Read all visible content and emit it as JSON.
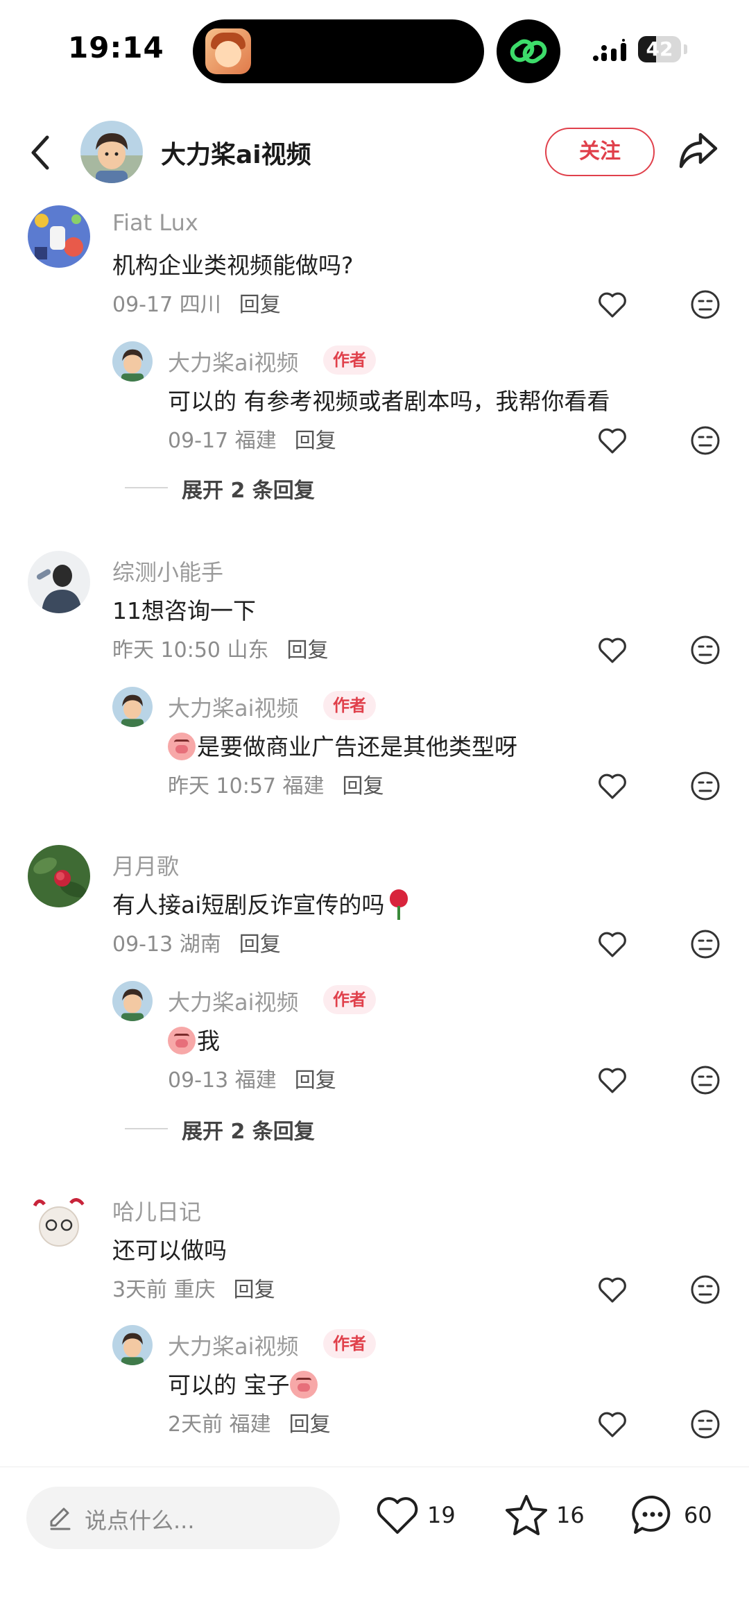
{
  "status_bar": {
    "time": "19:14",
    "battery": "42",
    "battery_level": 0.42
  },
  "header": {
    "title": "大力桨ai视频",
    "follow_label": "关注"
  },
  "comments": [
    {
      "user": "Fiat Lux",
      "text": "机构企业类视频能做吗?",
      "date_location": "09-17 四川",
      "reply_label": "回复",
      "author_reply": {
        "user": "大力桨ai视频",
        "tag": "作者",
        "text": "可以的 有参考视频或者剧本吗，我帮你看看",
        "date_location": "09-17 福建",
        "reply_label": "回复"
      },
      "expand_label": "展开 2 条回复"
    },
    {
      "user": "综测小能手",
      "text": "11想咨询一下",
      "date_location": "昨天 10:50 山东",
      "reply_label": "回复",
      "author_reply": {
        "user": "大力桨ai视频",
        "tag": "作者",
        "text": "是要做商业广告还是其他类型呀",
        "date_location": "昨天 10:57 福建",
        "reply_label": "回复"
      }
    },
    {
      "user": "月月歌",
      "text": "有人接ai短剧反诈宣传的吗",
      "date_location": "09-13 湖南",
      "reply_label": "回复",
      "author_reply": {
        "user": "大力桨ai视频",
        "tag": "作者",
        "text": "我",
        "date_location": "09-13 福建",
        "reply_label": "回复"
      },
      "expand_label": "展开 2 条回复"
    },
    {
      "user": "哈儿日记",
      "text": "还可以做吗",
      "date_location": "3天前 重庆",
      "reply_label": "回复",
      "author_reply": {
        "user": "大力桨ai视频",
        "tag": "作者",
        "text": "可以的 宝子",
        "date_location": "2天前 福建",
        "reply_label": "回复"
      }
    }
  ],
  "bottom_bar": {
    "input_placeholder": "说点什么...",
    "likes": "19",
    "favorites": "16",
    "comments": "60"
  },
  "colors": {
    "accent": "#e0404b",
    "author_tag_bg": "#fdecef",
    "muted_text": "#9a9a9a"
  },
  "icons": [
    "back-icon",
    "share-icon",
    "heart-icon",
    "dislike-face-icon",
    "pencil-icon",
    "star-icon",
    "comment-bubble-icon",
    "link-icon",
    "signal-icon",
    "battery-icon"
  ]
}
